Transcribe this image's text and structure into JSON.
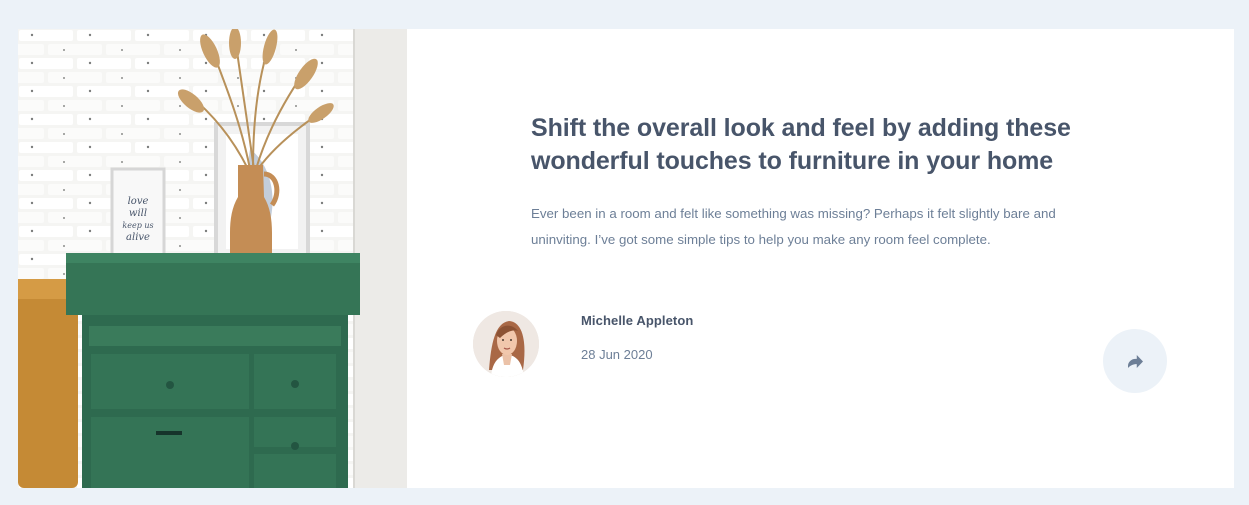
{
  "article": {
    "title": "Shift the overall look and feel by adding these wonderful touches to furniture in your home",
    "excerpt": "Ever been in a room and felt like something was missing? Perhaps it felt slightly bare and uninviting. I’ve got some simple tips to help you make any room feel complete.",
    "image": {
      "description": "green dresser with vase and framed prints against white brick wall",
      "framed_print_text": [
        "love",
        "will",
        "keep us",
        "alive"
      ]
    }
  },
  "author": {
    "name": "Michelle Appleton",
    "date": "28 Jun 2020",
    "avatar_icon": "avatar-photo"
  },
  "share": {
    "icon": "share-icon",
    "button_color": "#ecf2f8",
    "icon_color": "#6d7f97"
  },
  "colors": {
    "page_background": "#ecf2f8",
    "heading": "#48556a",
    "body_text": "#6d7f97"
  }
}
